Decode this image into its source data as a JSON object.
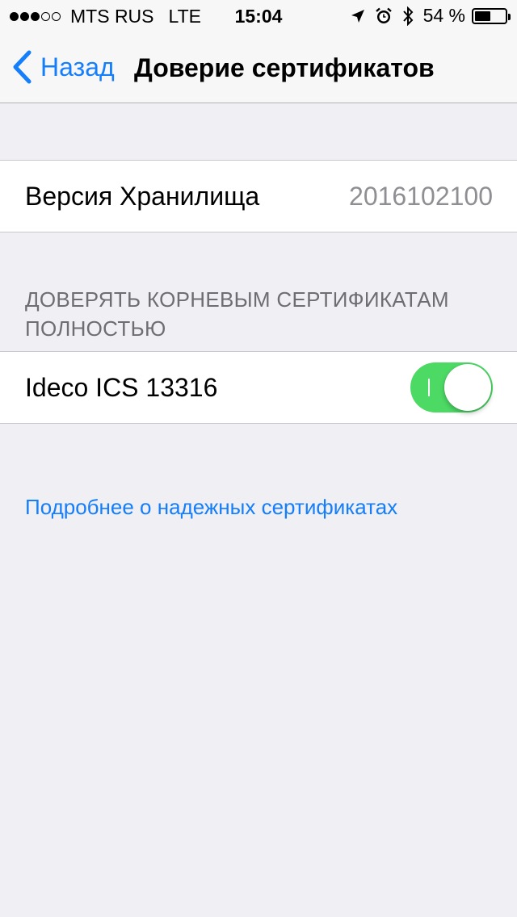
{
  "status_bar": {
    "signal_filled": 3,
    "signal_total": 5,
    "carrier": "MTS RUS",
    "network": "LTE",
    "time": "15:04",
    "icons": [
      "location-arrow-icon",
      "alarm-clock-icon",
      "bluetooth-icon"
    ],
    "battery_percent_label": "54 %",
    "battery_level": 0.54
  },
  "nav": {
    "back_label": "Назад",
    "title": "Доверие сертификатов",
    "accent_color": "#147efb"
  },
  "store_version": {
    "label": "Версия Хранилища",
    "value": "2016102100"
  },
  "trust_section": {
    "header": "ДОВЕРЯТЬ КОРНЕВЫМ СЕРТИФИКАТАМ ПОЛНОСТЬЮ",
    "items": [
      {
        "label": "Ideco ICS 13316",
        "enabled": true
      }
    ],
    "toggle_on_color": "#4cd964"
  },
  "footer": {
    "link": "Подробнее о надежных сертификатах"
  }
}
